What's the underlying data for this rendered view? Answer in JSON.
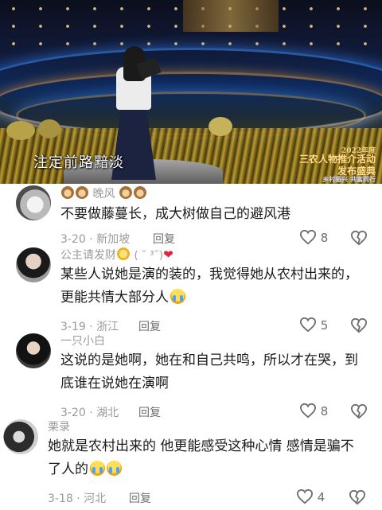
{
  "video": {
    "caption": "注定前路黯淡",
    "logo": {
      "year": "2022年度",
      "main": "三农人物推介活动",
      "sub": "发布盛典",
      "tag": "乡村振兴 共富同行"
    }
  },
  "comments": [
    {
      "username": "晚风",
      "text": "不要做藤蔓长，成大树做自己的避风港",
      "date": "3-20",
      "location": "新加坡",
      "reply_label": "回复",
      "likes": "8"
    },
    {
      "username": "公主请发财",
      "username_suffix": "( ˘ ³˘)",
      "text": "某些人说她是演的装的，我觉得她从农村出来的，更能共情大部分人",
      "date": "3-19",
      "location": "浙江",
      "reply_label": "回复",
      "likes": "5"
    },
    {
      "username": "一只小白",
      "text": "这说的是她啊，她在和自己共鸣，所以才在哭，到底谁在说她在演啊",
      "date": "3-20",
      "location": "湖北",
      "reply_label": "回复",
      "likes": "8"
    },
    {
      "username": "栗录",
      "text": "她就是农村出来的 他更能感受这种心情 感情是骗不了人的",
      "date": "3-18",
      "location": "河北",
      "reply_label": "回复",
      "likes": "4"
    }
  ],
  "icons": {
    "like": "heart-outline-icon",
    "dislike": "broken-heart-icon"
  }
}
